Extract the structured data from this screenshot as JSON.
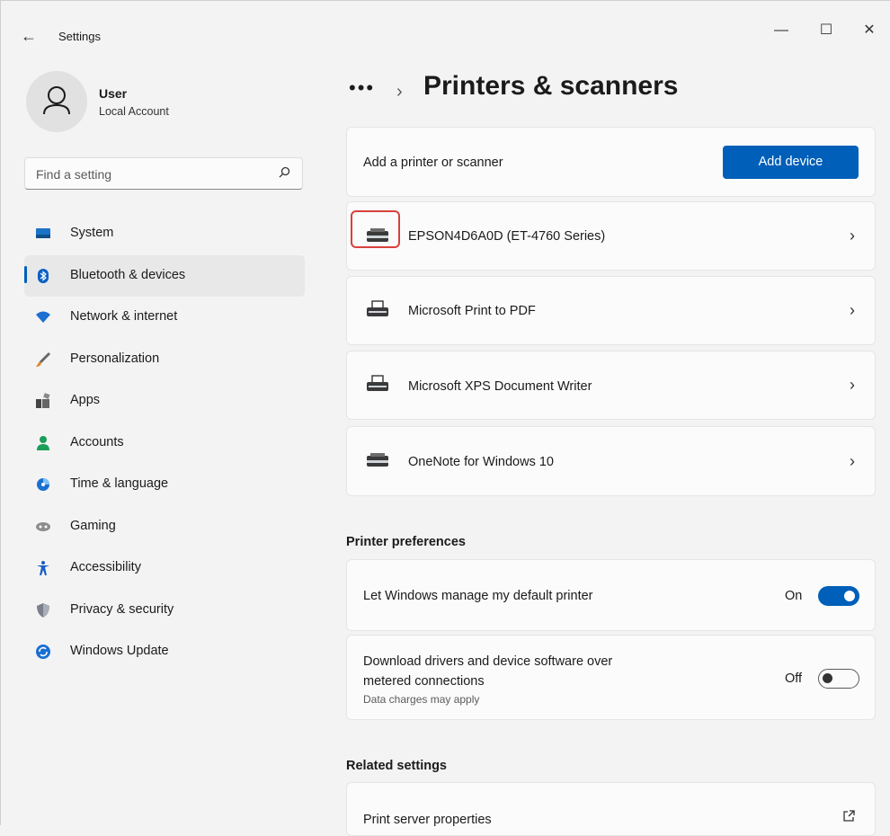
{
  "window": {
    "title": "Settings",
    "back_glyph": "←",
    "minimize_glyph": "—",
    "maximize_glyph": "☐",
    "close_glyph": "✕"
  },
  "user": {
    "name": "User",
    "account_type": "Local Account"
  },
  "search": {
    "placeholder": "Find a setting"
  },
  "nav": {
    "items": [
      {
        "label": "System",
        "icon": "system-icon",
        "active": false
      },
      {
        "label": "Bluetooth & devices",
        "icon": "bluetooth-icon",
        "active": true
      },
      {
        "label": "Network & internet",
        "icon": "wifi-icon",
        "active": false
      },
      {
        "label": "Personalization",
        "icon": "brush-icon",
        "active": false
      },
      {
        "label": "Apps",
        "icon": "apps-icon",
        "active": false
      },
      {
        "label": "Accounts",
        "icon": "accounts-icon",
        "active": false
      },
      {
        "label": "Time & language",
        "icon": "globe-clock-icon",
        "active": false
      },
      {
        "label": "Gaming",
        "icon": "gamepad-icon",
        "active": false
      },
      {
        "label": "Accessibility",
        "icon": "accessibility-icon",
        "active": false
      },
      {
        "label": "Privacy & security",
        "icon": "shield-icon",
        "active": false
      },
      {
        "label": "Windows Update",
        "icon": "update-icon",
        "active": false
      }
    ]
  },
  "header": {
    "breadcrumb_more": "•••",
    "breadcrumb_separator": "›",
    "title": "Printers & scanners"
  },
  "add_printer": {
    "label": "Add a printer or scanner",
    "button": "Add device"
  },
  "devices": [
    {
      "name": "EPSON4D6A0D (ET-4760 Series)",
      "icon": "printer-icon",
      "highlighted": true
    },
    {
      "name": "Microsoft Print to PDF",
      "icon": "virtual-printer-icon",
      "highlighted": false
    },
    {
      "name": "Microsoft XPS Document Writer",
      "icon": "virtual-printer-icon",
      "highlighted": false
    },
    {
      "name": "OneNote for Windows 10",
      "icon": "printer-icon",
      "highlighted": false
    }
  ],
  "chevron_glyph": "›",
  "printer_preferences": {
    "title": "Printer preferences",
    "default_printer": {
      "label": "Let Windows manage my default printer",
      "state": "On"
    },
    "metered": {
      "label_line1": "Download drivers and device software over",
      "label_line2": "metered connections",
      "sub": "Data charges may apply",
      "state": "Off"
    }
  },
  "related": {
    "title": "Related settings",
    "items": [
      {
        "label": "Print server properties",
        "icon": "external-link-icon"
      }
    ]
  },
  "colors": {
    "accent": "#005fb8",
    "highlight_box": "#d9413c"
  }
}
